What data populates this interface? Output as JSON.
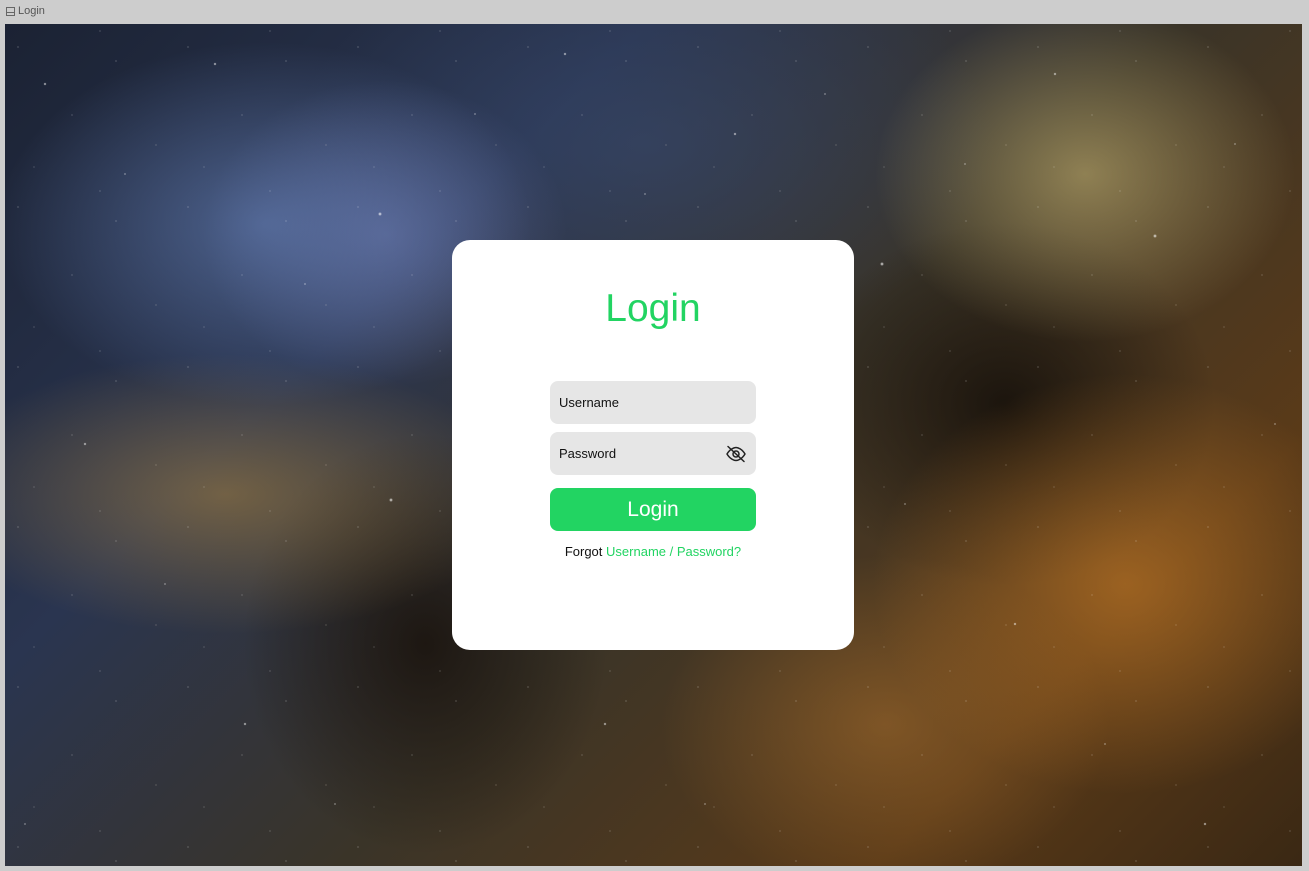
{
  "window": {
    "title": "Login",
    "frame_icon": "frame-icon"
  },
  "background": {
    "description_icon": "nebula-background"
  },
  "login_card": {
    "title": "Login",
    "username_placeholder": "Username",
    "password_placeholder": "Password",
    "password_toggle_icon": "eye-off-icon",
    "submit_label": "Login",
    "forgot_prefix": "Forgot",
    "forgot_link": "Username / Password?"
  },
  "colors": {
    "accent": "#22d462",
    "card": "#ffffff",
    "field": "#e6e6e6",
    "frame_bg": "#cdcdcd"
  }
}
